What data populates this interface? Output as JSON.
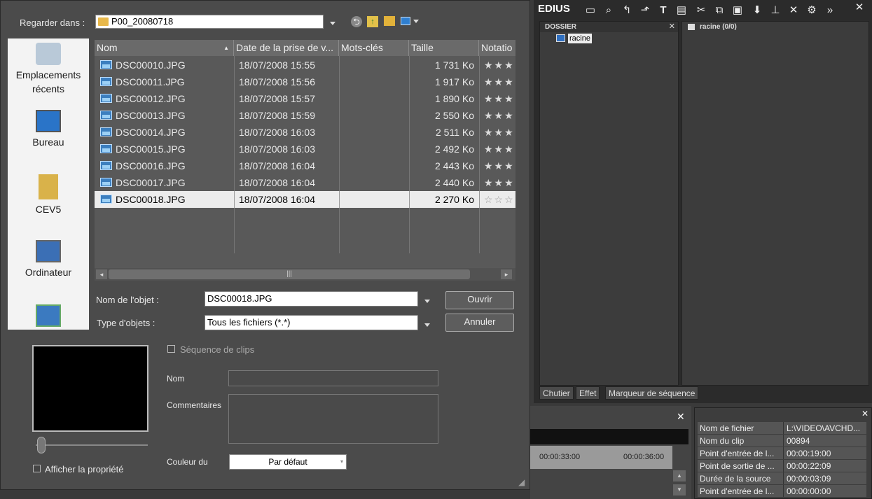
{
  "dialog": {
    "look_in_label": "Regarder dans :",
    "look_in_value": "P00_20080718",
    "places": [
      {
        "label": "Emplacements récents",
        "icon": "recent-places-icon"
      },
      {
        "label": "Bureau",
        "icon": "desktop-icon"
      },
      {
        "label": "CEV5",
        "icon": "user-folder-icon"
      },
      {
        "label": "Ordinateur",
        "icon": "computer-icon"
      },
      {
        "label": "",
        "icon": "network-icon"
      }
    ],
    "columns": [
      "Nom",
      "Date de la prise de v...",
      "Mots-clés",
      "Taille",
      "Notatio"
    ],
    "files": [
      {
        "name": "DSC00010.JPG",
        "date": "18/07/2008 15:55",
        "size": "1 731 Ko",
        "rating": "★★★"
      },
      {
        "name": "DSC00011.JPG",
        "date": "18/07/2008 15:56",
        "size": "1 917 Ko",
        "rating": "★★★"
      },
      {
        "name": "DSC00012.JPG",
        "date": "18/07/2008 15:57",
        "size": "1 890 Ko",
        "rating": "★★★"
      },
      {
        "name": "DSC00013.JPG",
        "date": "18/07/2008 15:59",
        "size": "2 550 Ko",
        "rating": "★★★"
      },
      {
        "name": "DSC00014.JPG",
        "date": "18/07/2008 16:03",
        "size": "2 511 Ko",
        "rating": "★★★"
      },
      {
        "name": "DSC00015.JPG",
        "date": "18/07/2008 16:03",
        "size": "2 492 Ko",
        "rating": "★★★"
      },
      {
        "name": "DSC00016.JPG",
        "date": "18/07/2008 16:04",
        "size": "2 443 Ko",
        "rating": "★★★"
      },
      {
        "name": "DSC00017.JPG",
        "date": "18/07/2008 16:04",
        "size": "2 440 Ko",
        "rating": "★★★"
      },
      {
        "name": "DSC00018.JPG",
        "date": "18/07/2008 16:04",
        "size": "2 270 Ko",
        "rating": "☆☆☆"
      }
    ],
    "selected_file_index": 8,
    "scroll_grip": "|||",
    "object_name_label": "Nom de l'objet :",
    "object_name_value": "DSC00018.JPG",
    "object_type_label": "Type d'objets :",
    "object_type_value": "Tous les fichiers (*.*)",
    "open_button": "Ouvrir",
    "cancel_button": "Annuler",
    "clip_sequence_label": "Séquence de clips",
    "name_label": "Nom",
    "comments_label": "Commentaires",
    "color_label": "Couleur du",
    "color_value": "Par défaut",
    "show_property_label": "Afficher la propriété"
  },
  "edius": {
    "title": "EDIUS",
    "folder_pane_title": "DOSSIER",
    "root_label": "racine",
    "bin_title": "racine (0/0)",
    "tabs": [
      "Chutier",
      "Effet",
      "Marqueur de séquence"
    ],
    "timecodes": [
      "00:00:33:00",
      "00:00:36:00"
    ],
    "properties": [
      {
        "key": "Nom de fichier",
        "value": "L:\\VIDEO\\AVCHD..."
      },
      {
        "key": "Nom du clip",
        "value": "00894"
      },
      {
        "key": "Point d'entrée de l...",
        "value": "00:00:19:00"
      },
      {
        "key": "Point de sortie de ...",
        "value": "00:00:22:09"
      },
      {
        "key": "Durée de la source",
        "value": "00:00:03:09"
      },
      {
        "key": "Point d'entrée de l...",
        "value": "00:00:00:00"
      }
    ]
  },
  "colors": {
    "selection": "#ececec",
    "dialog_bg": "#4b4b4b",
    "edius_bg": "#2b2b2b",
    "accent_folder": "#e8b84a"
  }
}
